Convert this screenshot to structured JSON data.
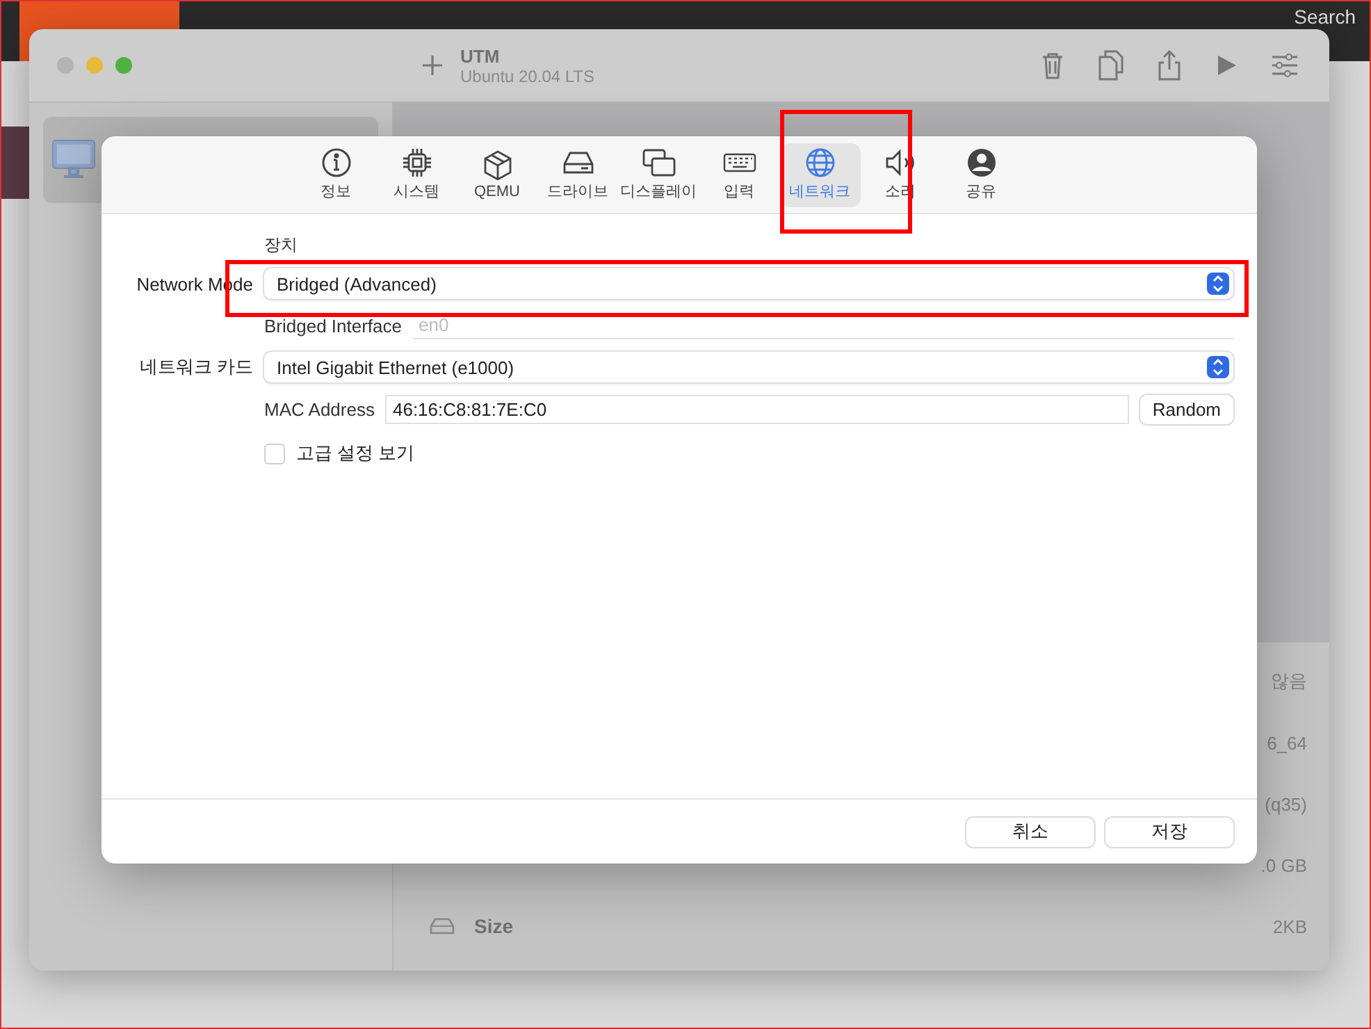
{
  "browser": {
    "search_label": "Search"
  },
  "window": {
    "title": "UTM",
    "subtitle": "Ubuntu 20.04 LTS",
    "details": [
      {
        "value": "않음"
      },
      {
        "value": "6_64"
      },
      {
        "value": "(q35)"
      },
      {
        "value": ".0 GB"
      },
      {
        "label": "Size",
        "value": "2KB"
      }
    ]
  },
  "dialog": {
    "tabs": [
      {
        "label": "정보",
        "selected": false
      },
      {
        "label": "시스템",
        "selected": false
      },
      {
        "label": "QEMU",
        "selected": false
      },
      {
        "label": "드라이브",
        "selected": false
      },
      {
        "label": "디스플레이",
        "selected": false
      },
      {
        "label": "입력",
        "selected": false
      },
      {
        "label": "네트워크",
        "selected": true
      },
      {
        "label": "소리",
        "selected": false
      },
      {
        "label": "공유",
        "selected": false
      }
    ],
    "section_title": "장치",
    "rows": [
      {
        "kind": "popup",
        "label": "Network Mode",
        "value": "Bridged (Advanced)"
      },
      {
        "kind": "field",
        "label": "Bridged Interface",
        "placeholder": "en0"
      },
      {
        "kind": "popup",
        "label": "네트워크 카드",
        "value": "Intel Gigabit Ethernet (e1000)"
      },
      {
        "kind": "field_button",
        "label": "MAC Address",
        "value": "46:16:C8:81:7E:C0",
        "button": "Random"
      },
      {
        "kind": "checkbox",
        "label": "고급 설정 보기",
        "checked": false
      }
    ],
    "buttons": [
      {
        "label": "취소"
      },
      {
        "label": "저장"
      }
    ]
  }
}
